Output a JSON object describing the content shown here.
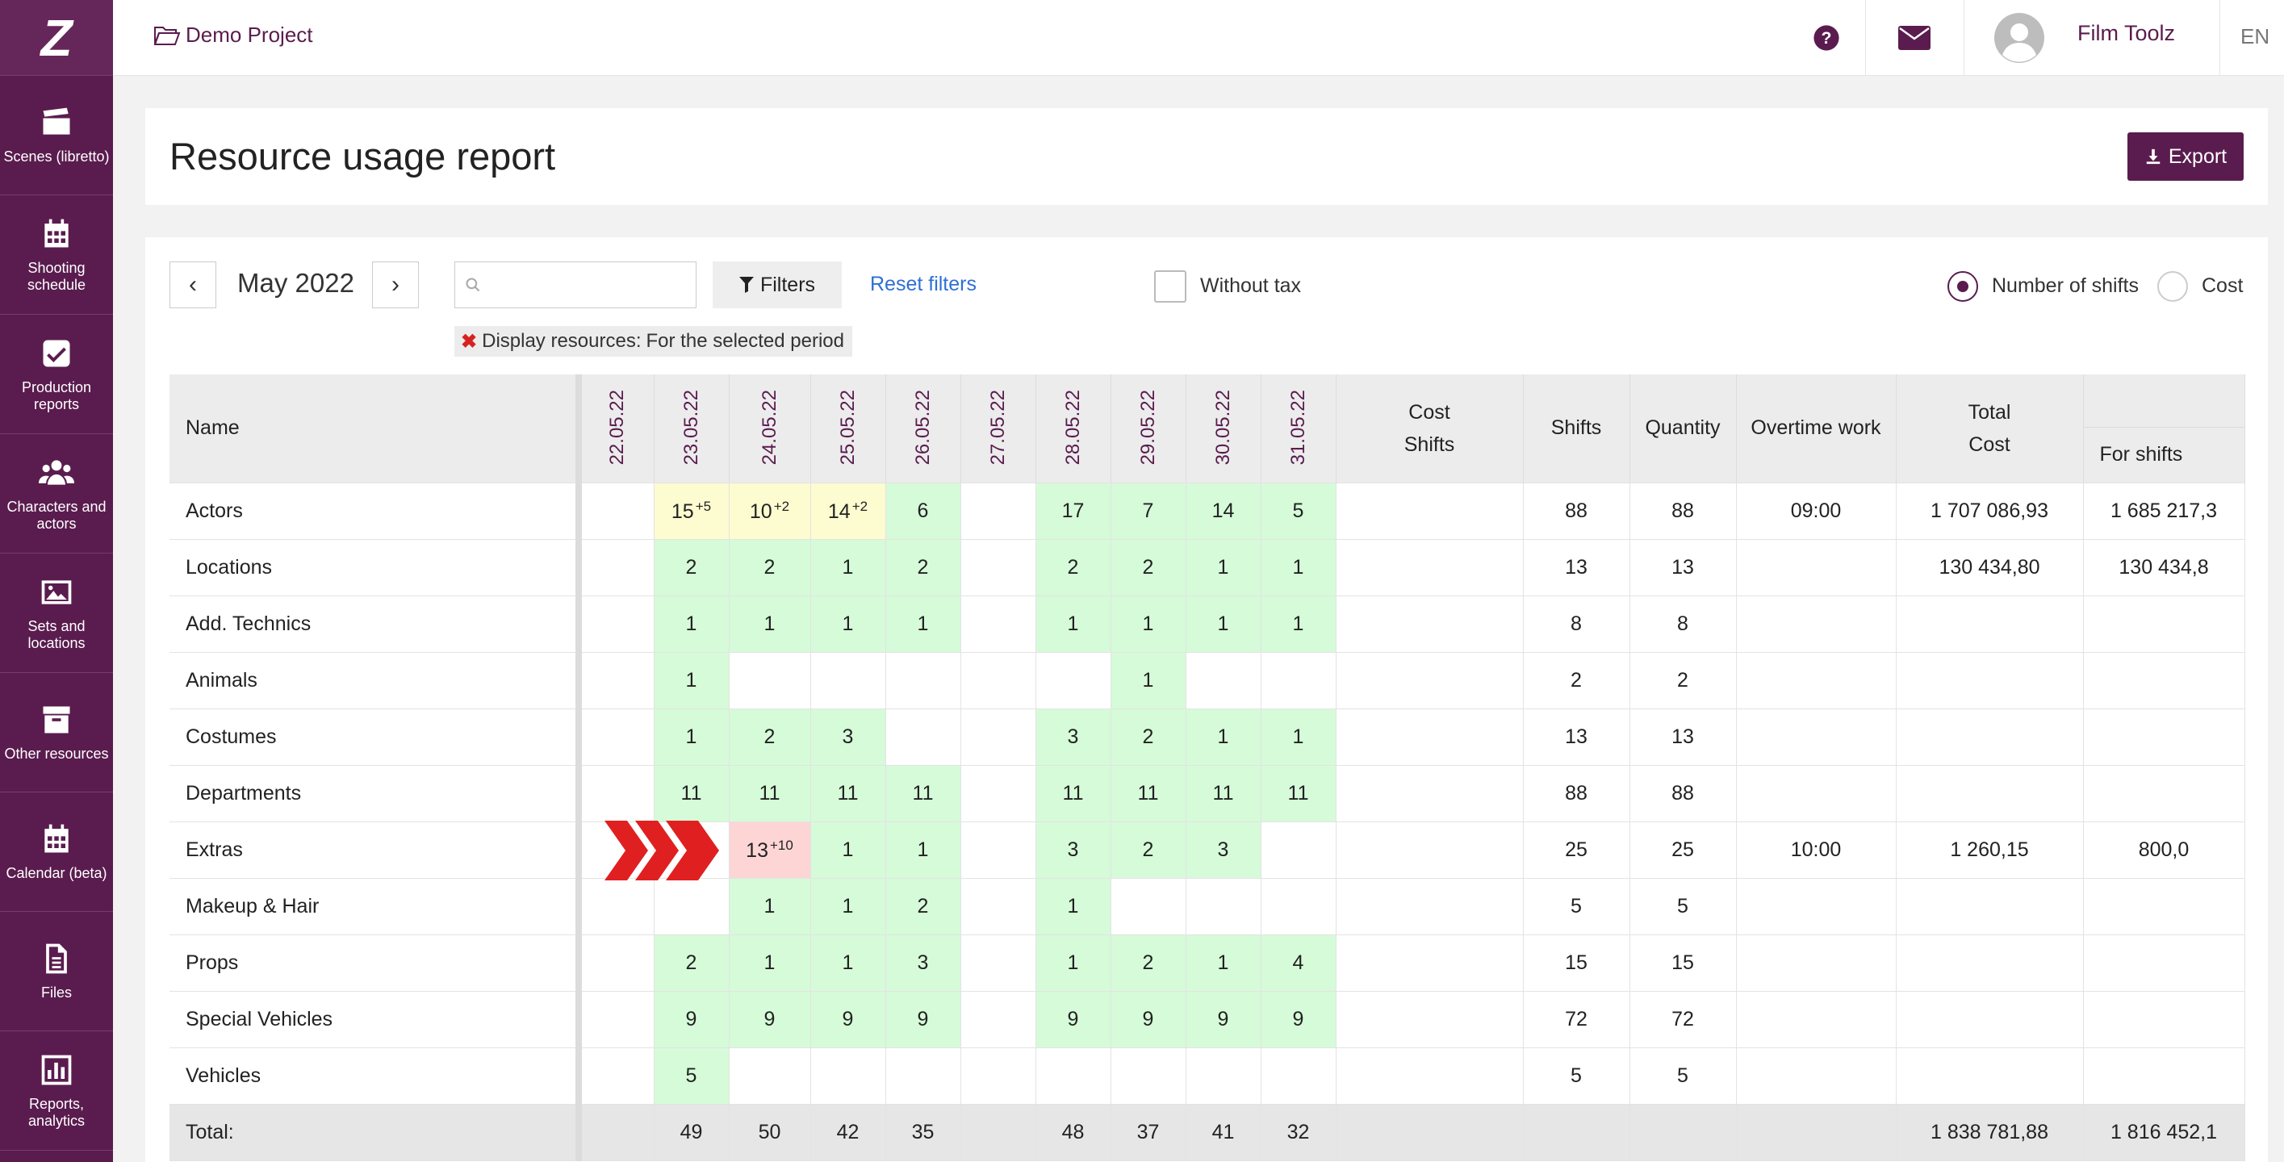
{
  "app": {
    "logo_text": "Z",
    "project": "Demo Project",
    "user_name": "Film Toolz",
    "language": "EN"
  },
  "sidebar": {
    "items": [
      {
        "label": "Scenes (libretto)",
        "icon": "clapperboard-icon"
      },
      {
        "label": "Shooting schedule",
        "icon": "calendar-icon"
      },
      {
        "label": "Production reports",
        "icon": "checkbox-icon"
      },
      {
        "label": "Characters and actors",
        "icon": "people-icon"
      },
      {
        "label": "Sets and locations",
        "icon": "image-icon"
      },
      {
        "label": "Other resources",
        "icon": "archive-icon"
      },
      {
        "label": "Calendar (beta)",
        "icon": "calendar-icon"
      },
      {
        "label": "Files",
        "icon": "file-icon"
      },
      {
        "label": "Reports, analytics",
        "icon": "bar-chart-icon"
      }
    ]
  },
  "page": {
    "title": "Resource usage report",
    "export_label": "Export"
  },
  "toolbar": {
    "prev": "‹",
    "next": "›",
    "month": "May 2022",
    "search_placeholder": "",
    "filters_label": "Filters",
    "reset_label": "Reset filters",
    "without_tax_label": "Without tax",
    "mode_shifts_label": "Number of shifts",
    "mode_cost_label": "Cost",
    "chip_label": "Display resources:",
    "chip_value": "For the selected period"
  },
  "table": {
    "name_header": "Name",
    "dates": [
      "22.05.22",
      "23.05.22",
      "24.05.22",
      "25.05.22",
      "26.05.22",
      "27.05.22",
      "28.05.22",
      "29.05.22",
      "30.05.22",
      "31.05.22"
    ],
    "cost_header_1": "Cost",
    "cost_header_2": "Shifts",
    "shifts_header": "Shifts",
    "quantity_header": "Quantity",
    "overtime_header": "Overtime work",
    "total_header_1": "Total",
    "total_header_2": "Cost",
    "for_shifts_header": "For shifts",
    "rows": [
      {
        "name": "Actors",
        "cells": [
          {
            "v": "",
            "c": ""
          },
          {
            "v": "15",
            "s": "+5",
            "c": "y"
          },
          {
            "v": "10",
            "s": "+2",
            "c": "y"
          },
          {
            "v": "14",
            "s": "+2",
            "c": "y"
          },
          {
            "v": "6",
            "c": "g"
          },
          {
            "v": "",
            "c": ""
          },
          {
            "v": "17",
            "c": "g"
          },
          {
            "v": "7",
            "c": "g"
          },
          {
            "v": "14",
            "c": "g"
          },
          {
            "v": "5",
            "c": "g"
          }
        ],
        "cost_shifts": "",
        "shifts": "88",
        "quantity": "88",
        "overtime": "09:00",
        "total": "1 707 086,93",
        "for_shifts": "1 685 217,3"
      },
      {
        "name": "Locations",
        "cells": [
          {
            "v": "",
            "c": ""
          },
          {
            "v": "2",
            "c": "g"
          },
          {
            "v": "2",
            "c": "g"
          },
          {
            "v": "1",
            "c": "g"
          },
          {
            "v": "2",
            "c": "g"
          },
          {
            "v": "",
            "c": ""
          },
          {
            "v": "2",
            "c": "g"
          },
          {
            "v": "2",
            "c": "g"
          },
          {
            "v": "1",
            "c": "g"
          },
          {
            "v": "1",
            "c": "g"
          }
        ],
        "cost_shifts": "",
        "shifts": "13",
        "quantity": "13",
        "overtime": "",
        "total": "130 434,80",
        "for_shifts": "130 434,8"
      },
      {
        "name": "Add. Technics",
        "cells": [
          {
            "v": "",
            "c": ""
          },
          {
            "v": "1",
            "c": "g"
          },
          {
            "v": "1",
            "c": "g"
          },
          {
            "v": "1",
            "c": "g"
          },
          {
            "v": "1",
            "c": "g"
          },
          {
            "v": "",
            "c": ""
          },
          {
            "v": "1",
            "c": "g"
          },
          {
            "v": "1",
            "c": "g"
          },
          {
            "v": "1",
            "c": "g"
          },
          {
            "v": "1",
            "c": "g"
          }
        ],
        "cost_shifts": "",
        "shifts": "8",
        "quantity": "8",
        "overtime": "",
        "total": "",
        "for_shifts": ""
      },
      {
        "name": "Animals",
        "cells": [
          {
            "v": "",
            "c": ""
          },
          {
            "v": "1",
            "c": "g"
          },
          {
            "v": "",
            "c": ""
          },
          {
            "v": "",
            "c": ""
          },
          {
            "v": "",
            "c": ""
          },
          {
            "v": "",
            "c": ""
          },
          {
            "v": "",
            "c": ""
          },
          {
            "v": "1",
            "c": "g"
          },
          {
            "v": "",
            "c": ""
          },
          {
            "v": "",
            "c": ""
          }
        ],
        "cost_shifts": "",
        "shifts": "2",
        "quantity": "2",
        "overtime": "",
        "total": "",
        "for_shifts": ""
      },
      {
        "name": "Costumes",
        "cells": [
          {
            "v": "",
            "c": ""
          },
          {
            "v": "1",
            "c": "g"
          },
          {
            "v": "2",
            "c": "g"
          },
          {
            "v": "3",
            "c": "g"
          },
          {
            "v": "",
            "c": ""
          },
          {
            "v": "",
            "c": ""
          },
          {
            "v": "3",
            "c": "g"
          },
          {
            "v": "2",
            "c": "g"
          },
          {
            "v": "1",
            "c": "g"
          },
          {
            "v": "1",
            "c": "g"
          }
        ],
        "cost_shifts": "",
        "shifts": "13",
        "quantity": "13",
        "overtime": "",
        "total": "",
        "for_shifts": ""
      },
      {
        "name": "Departments",
        "cells": [
          {
            "v": "",
            "c": ""
          },
          {
            "v": "11",
            "c": "g"
          },
          {
            "v": "11",
            "c": "g"
          },
          {
            "v": "11",
            "c": "g"
          },
          {
            "v": "11",
            "c": "g"
          },
          {
            "v": "",
            "c": ""
          },
          {
            "v": "11",
            "c": "g"
          },
          {
            "v": "11",
            "c": "g"
          },
          {
            "v": "11",
            "c": "g"
          },
          {
            "v": "11",
            "c": "g"
          }
        ],
        "cost_shifts": "",
        "shifts": "88",
        "quantity": "88",
        "overtime": "",
        "total": "",
        "for_shifts": ""
      },
      {
        "name": "Extras",
        "arrow": true,
        "cells": [
          {
            "v": "",
            "c": ""
          },
          {
            "v": "",
            "c": ""
          },
          {
            "v": "13",
            "s": "+10",
            "c": "p"
          },
          {
            "v": "1",
            "c": "g"
          },
          {
            "v": "1",
            "c": "g"
          },
          {
            "v": "",
            "c": ""
          },
          {
            "v": "3",
            "c": "g"
          },
          {
            "v": "2",
            "c": "g"
          },
          {
            "v": "3",
            "c": "g"
          },
          {
            "v": "",
            "c": ""
          }
        ],
        "cost_shifts": "",
        "shifts": "25",
        "quantity": "25",
        "overtime": "10:00",
        "total": "1 260,15",
        "for_shifts": "800,0"
      },
      {
        "name": "Makeup & Hair",
        "cells": [
          {
            "v": "",
            "c": ""
          },
          {
            "v": "",
            "c": ""
          },
          {
            "v": "1",
            "c": "g"
          },
          {
            "v": "1",
            "c": "g"
          },
          {
            "v": "2",
            "c": "g"
          },
          {
            "v": "",
            "c": ""
          },
          {
            "v": "1",
            "c": "g"
          },
          {
            "v": "",
            "c": ""
          },
          {
            "v": "",
            "c": ""
          },
          {
            "v": "",
            "c": ""
          }
        ],
        "cost_shifts": "",
        "shifts": "5",
        "quantity": "5",
        "overtime": "",
        "total": "",
        "for_shifts": ""
      },
      {
        "name": "Props",
        "cells": [
          {
            "v": "",
            "c": ""
          },
          {
            "v": "2",
            "c": "g"
          },
          {
            "v": "1",
            "c": "g"
          },
          {
            "v": "1",
            "c": "g"
          },
          {
            "v": "3",
            "c": "g"
          },
          {
            "v": "",
            "c": ""
          },
          {
            "v": "1",
            "c": "g"
          },
          {
            "v": "2",
            "c": "g"
          },
          {
            "v": "1",
            "c": "g"
          },
          {
            "v": "4",
            "c": "g"
          }
        ],
        "cost_shifts": "",
        "shifts": "15",
        "quantity": "15",
        "overtime": "",
        "total": "",
        "for_shifts": ""
      },
      {
        "name": "Special Vehicles",
        "cells": [
          {
            "v": "",
            "c": ""
          },
          {
            "v": "9",
            "c": "g"
          },
          {
            "v": "9",
            "c": "g"
          },
          {
            "v": "9",
            "c": "g"
          },
          {
            "v": "9",
            "c": "g"
          },
          {
            "v": "",
            "c": ""
          },
          {
            "v": "9",
            "c": "g"
          },
          {
            "v": "9",
            "c": "g"
          },
          {
            "v": "9",
            "c": "g"
          },
          {
            "v": "9",
            "c": "g"
          }
        ],
        "cost_shifts": "",
        "shifts": "72",
        "quantity": "72",
        "overtime": "",
        "total": "",
        "for_shifts": ""
      },
      {
        "name": "Vehicles",
        "cells": [
          {
            "v": "",
            "c": ""
          },
          {
            "v": "5",
            "c": "g"
          },
          {
            "v": "",
            "c": ""
          },
          {
            "v": "",
            "c": ""
          },
          {
            "v": "",
            "c": ""
          },
          {
            "v": "",
            "c": ""
          },
          {
            "v": "",
            "c": ""
          },
          {
            "v": "",
            "c": ""
          },
          {
            "v": "",
            "c": ""
          },
          {
            "v": "",
            "c": ""
          }
        ],
        "cost_shifts": "",
        "shifts": "5",
        "quantity": "5",
        "overtime": "",
        "total": "",
        "for_shifts": ""
      }
    ],
    "total_row": {
      "name": "Total:",
      "cells": [
        "",
        "49",
        "50",
        "42",
        "35",
        "",
        "48",
        "37",
        "41",
        "32"
      ],
      "cost_shifts": "",
      "shifts": "",
      "quantity": "",
      "overtime": "",
      "total": "1 838 781,88",
      "for_shifts": "1 816 452,1"
    }
  },
  "colors": {
    "brand": "#5a1c4e",
    "green_cell": "#d6fbd9",
    "yellow_cell": "#fdfbd0",
    "pink_cell": "#fdd5d5",
    "link": "#2f6fd6",
    "arrow": "#e02020"
  }
}
